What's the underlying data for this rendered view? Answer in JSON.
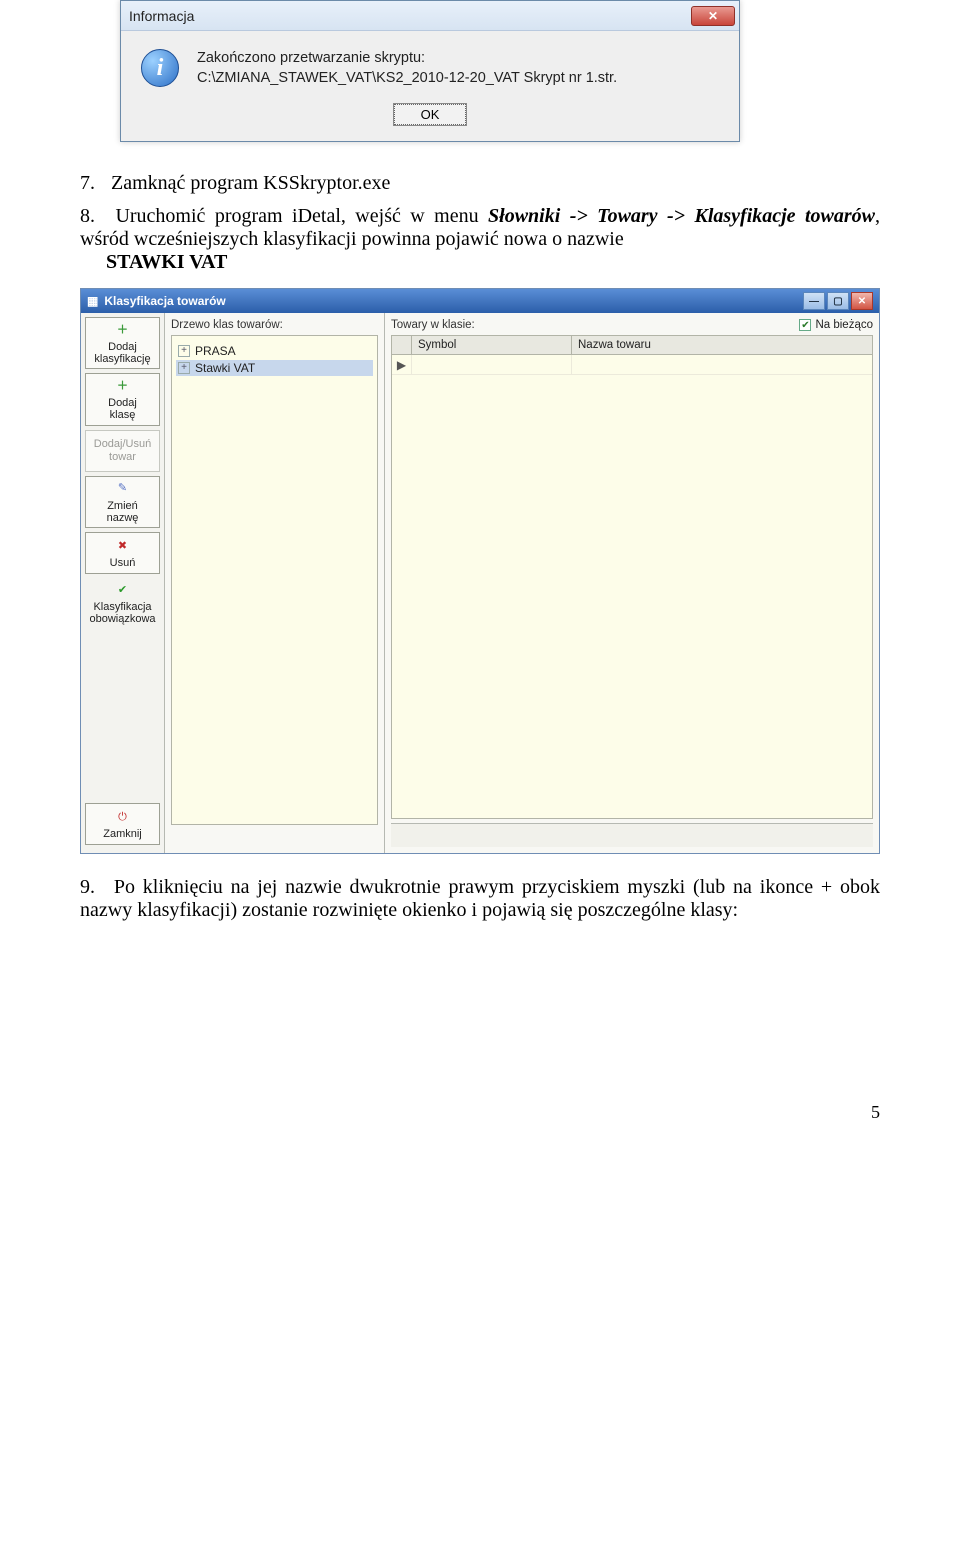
{
  "dialog": {
    "title": "Informacja",
    "msg_line1": "Zakończono przetwarzanie skryptu:",
    "msg_line2": "C:\\ZMIANA_STAWEK_VAT\\KS2_2010-12-20_VAT Skrypt nr 1.str.",
    "ok": "OK"
  },
  "step7": {
    "num": "7.",
    "text": "Zamknąć program KSSkryptor.exe"
  },
  "step8": {
    "num": "8.",
    "lead": "Uruchomić program iDetal, wejść w menu ",
    "path": "Słowniki -> Towary -> Klasyfikacje towarów",
    "mid": ", wśród wcześniejszych klasyfikacji powinna pojawić nowa o nazwie ",
    "name": "STAWKI VAT"
  },
  "app": {
    "title": "Klasyfikacja towarów",
    "tree_label": "Drzewo klas towarów:",
    "tree_items": [
      "PRASA",
      "Stawki VAT"
    ],
    "goods_label": "Towary w klasie:",
    "na_biezaco": "Na bieżąco",
    "col_symbol": "Symbol",
    "col_name": "Nazwa towaru"
  },
  "sidebar": {
    "dodaj_klas": "Dodaj\nklasyfikację",
    "dodaj_klase": "Dodaj\nklasę",
    "dodaj_usun": "Dodaj/Usuń\ntowar",
    "zmien": "Zmień\nnazwę",
    "usun": "Usuń",
    "obow": "Klasyfikacja\nobowiązkowa",
    "zamknij": "Zamknij"
  },
  "step9": {
    "num": "9.",
    "text": "Po kliknięciu na jej nazwie dwukrotnie prawym przyciskiem myszki (lub na ikonce + obok nazwy klasyfikacji) zostanie rozwinięte okienko i pojawią się poszczególne klasy:"
  },
  "pagenum": "5"
}
